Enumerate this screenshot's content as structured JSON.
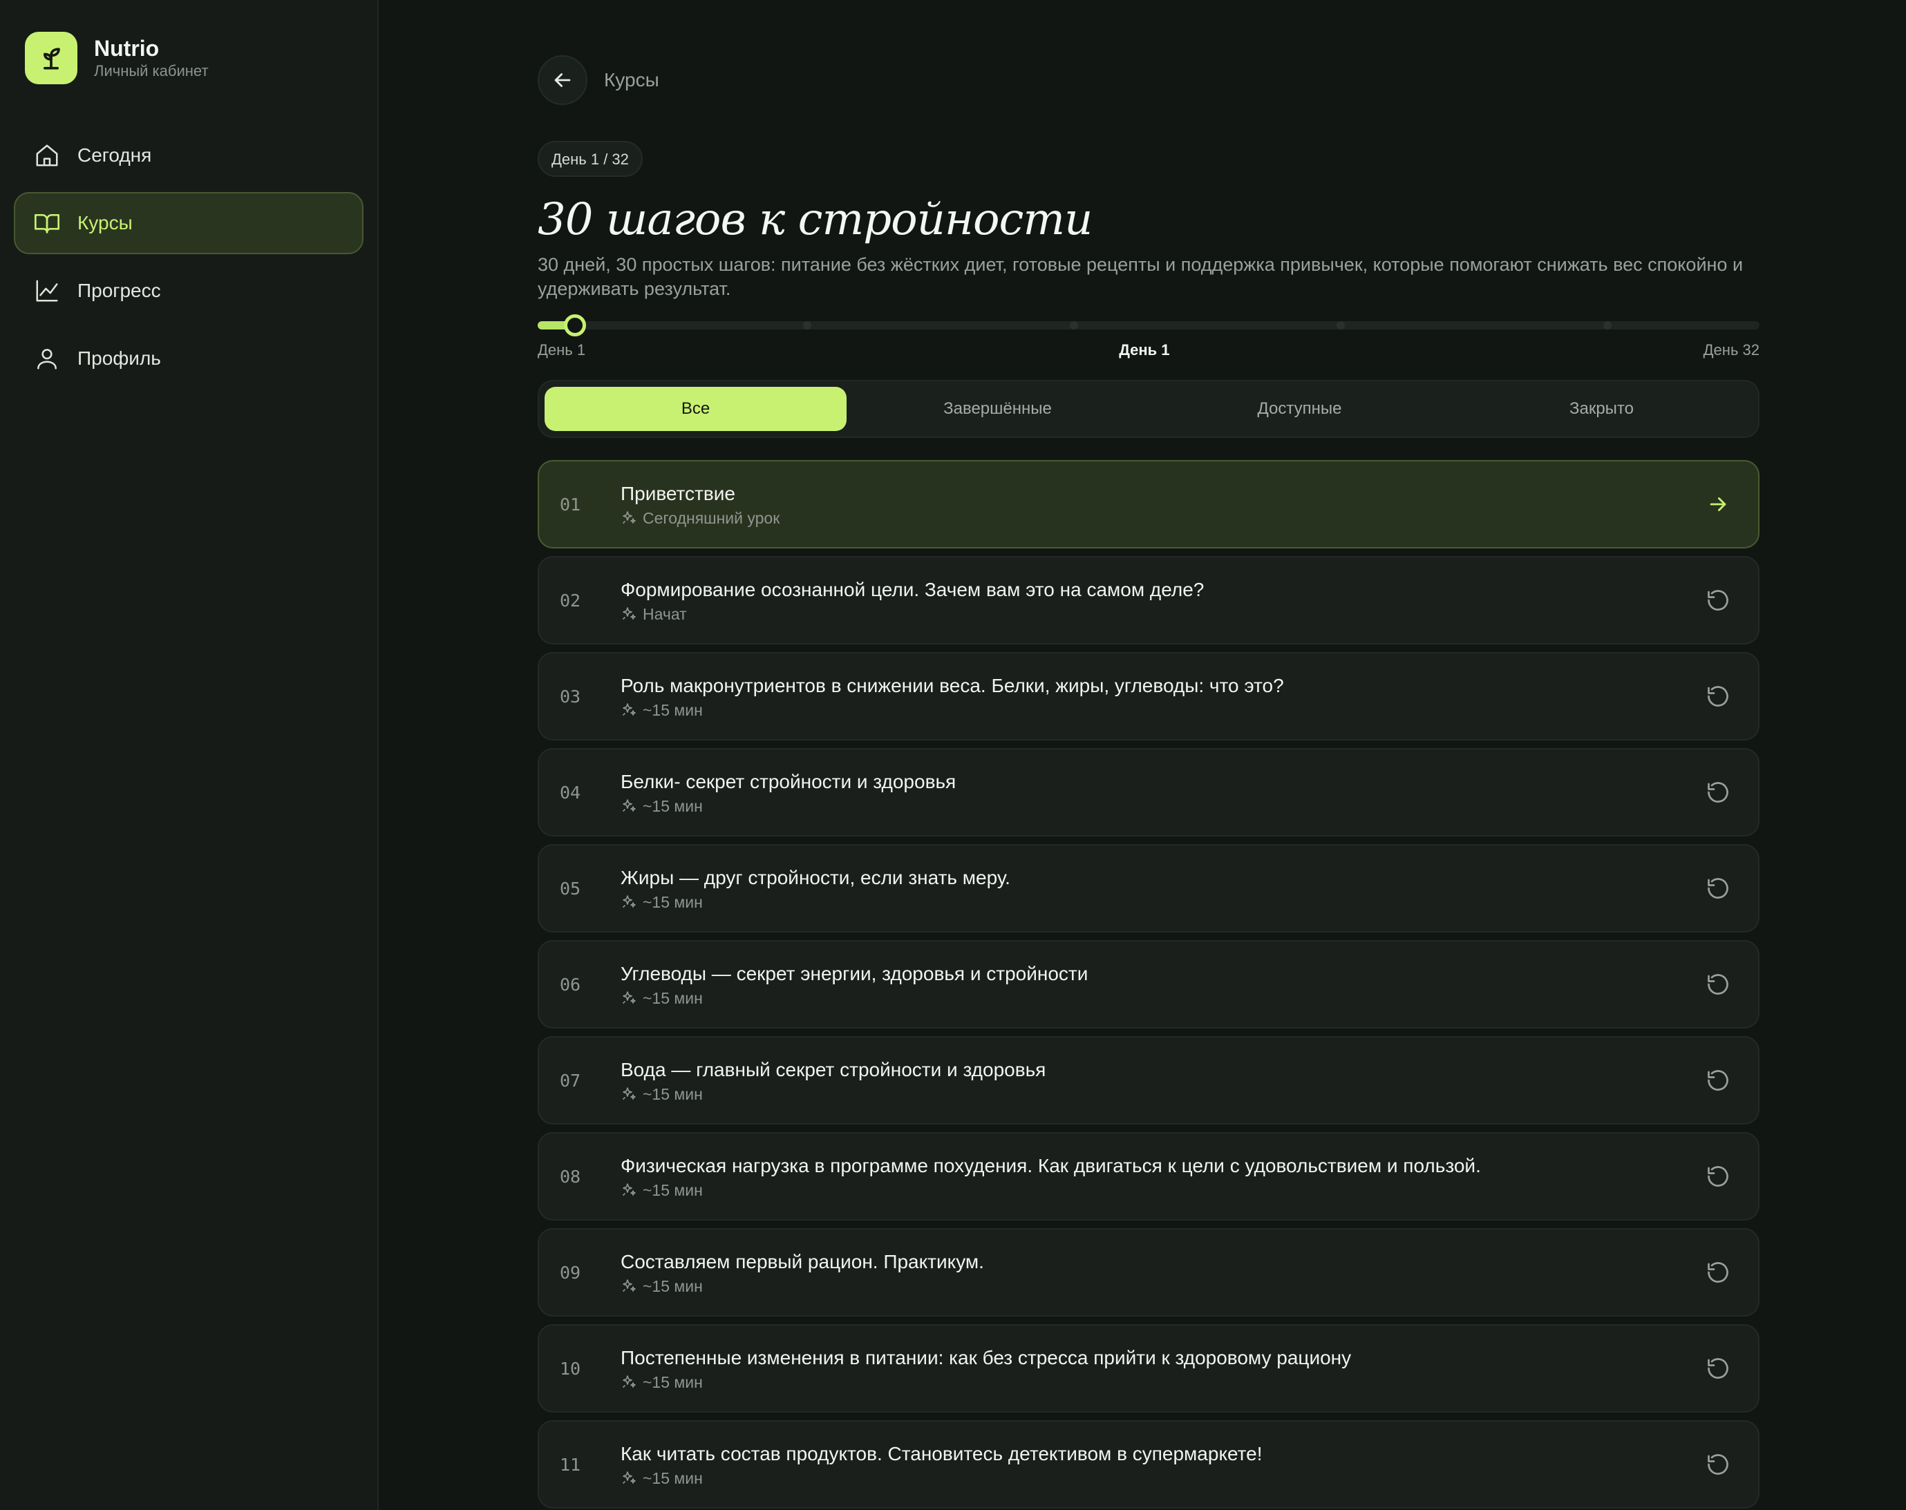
{
  "brand": {
    "name": "Nutrio",
    "subtitle": "Личный кабинет"
  },
  "sidebar": {
    "items": [
      {
        "label": "Сегодня",
        "icon": "home-icon",
        "active": false
      },
      {
        "label": "Курсы",
        "icon": "book-icon",
        "active": true
      },
      {
        "label": "Прогресс",
        "icon": "chart-line-icon",
        "active": false
      },
      {
        "label": "Профиль",
        "icon": "user-icon",
        "active": false
      }
    ]
  },
  "header": {
    "breadcrumb": "Курсы"
  },
  "course": {
    "day_badge": "День 1 / 32",
    "title": "30 шагов к стройности",
    "description": "30 дней, 30 простых шагов: питание без жёстких диет, готовые рецепты и поддержка привычек, которые помогают снижать вес спокойно и удерживать результат.",
    "progress": {
      "current_day": 1,
      "total_days": 32,
      "label_start": "День 1",
      "label_current": "День 1",
      "label_end": "День 32"
    }
  },
  "tabs": [
    {
      "label": "Все",
      "active": true
    },
    {
      "label": "Завершённые",
      "active": false
    },
    {
      "label": "Доступные",
      "active": false
    },
    {
      "label": "Закрыто",
      "active": false
    }
  ],
  "lessons": [
    {
      "num": "01",
      "title": "Приветствие",
      "meta": "Сегодняшний урок",
      "action": "arrow-right-icon",
      "current": true
    },
    {
      "num": "02",
      "title": "Формирование осознанной цели. Зачем вам это на самом деле?",
      "meta": "Начат",
      "action": "replay-icon"
    },
    {
      "num": "03",
      "title": "Роль макронутриентов в снижении веса. Белки, жиры, углеводы: что это?",
      "meta": "~15 мин",
      "action": "replay-icon"
    },
    {
      "num": "04",
      "title": "Белки- секрет стройности и здоровья",
      "meta": "~15 мин",
      "action": "replay-icon"
    },
    {
      "num": "05",
      "title": "Жиры — друг стройности, если знать меру.",
      "meta": "~15 мин",
      "action": "replay-icon"
    },
    {
      "num": "06",
      "title": "Углеводы — секрет энергии, здоровья и стройности",
      "meta": "~15 мин",
      "action": "replay-icon"
    },
    {
      "num": "07",
      "title": "Вода — главный секрет стройности и здоровья",
      "meta": "~15 мин",
      "action": "replay-icon"
    },
    {
      "num": "08",
      "title": "Физическая нагрузка в программе похудения. Как двигаться к цели с удовольствием и пользой.",
      "meta": "~15 мин",
      "action": "replay-icon"
    },
    {
      "num": "09",
      "title": "Составляем первый рацион. Практикум.",
      "meta": "~15 мин",
      "action": "replay-icon"
    },
    {
      "num": "10",
      "title": "Постепенные изменения в питании: как без стресса прийти к здоровому рациону",
      "meta": "~15 мин",
      "action": "replay-icon"
    },
    {
      "num": "11",
      "title": "Как читать состав продуктов. Становитесь детективом в супермаркете!",
      "meta": "~15 мин",
      "action": "replay-icon"
    }
  ],
  "colors": {
    "accent": "#c8f172",
    "background": "#111613",
    "sidebar": "#161b18"
  }
}
